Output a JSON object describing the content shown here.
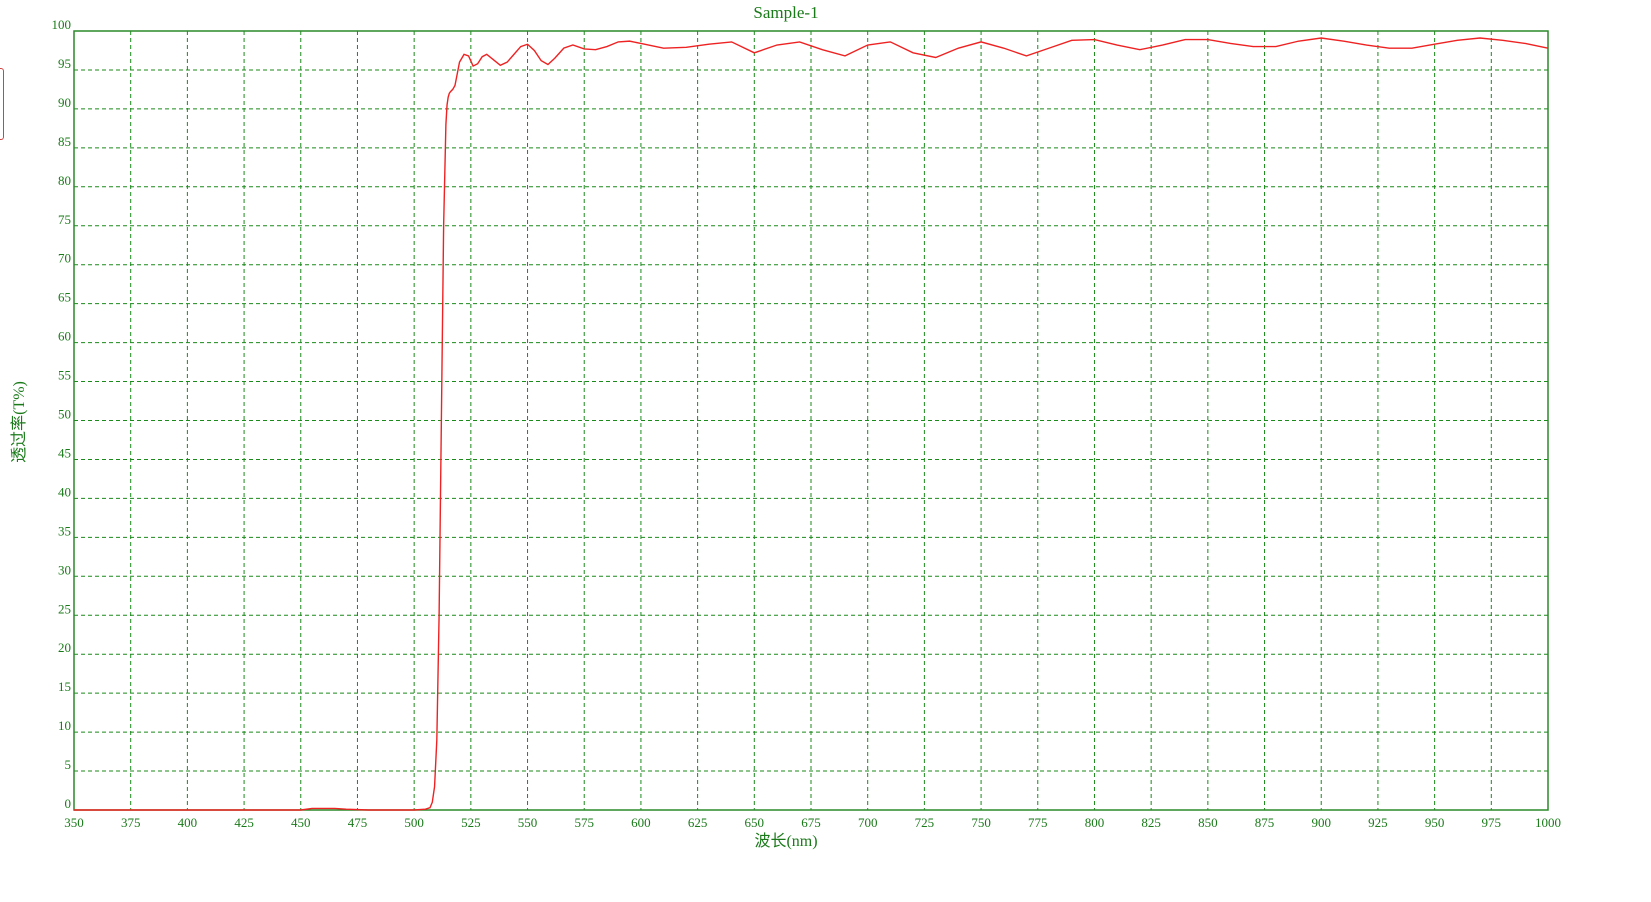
{
  "chart_data": {
    "type": "line",
    "title": "Sample-1",
    "xlabel": "波长(nm)",
    "ylabel": "透过率(T%)",
    "xlim": [
      350,
      1000
    ],
    "ylim": [
      0,
      100
    ],
    "x_ticks": [
      350,
      375,
      400,
      425,
      450,
      475,
      500,
      525,
      550,
      575,
      600,
      625,
      650,
      675,
      700,
      725,
      750,
      775,
      800,
      825,
      850,
      875,
      900,
      925,
      950,
      975,
      1000
    ],
    "y_ticks": [
      0,
      5,
      10,
      15,
      20,
      25,
      30,
      35,
      40,
      45,
      50,
      55,
      60,
      65,
      70,
      75,
      80,
      85,
      90,
      95,
      100
    ],
    "grid": true,
    "colors": {
      "series": "#ee2222",
      "axis": "#1a7a1a"
    },
    "series": [
      {
        "x": [
          350,
          400,
          450,
          455,
          465,
          470,
          480,
          490,
          500,
          505,
          507,
          508,
          509,
          510,
          511,
          512,
          513,
          514,
          514.5,
          515,
          515.5,
          516,
          517,
          518,
          519,
          520,
          522,
          524,
          526,
          528,
          530,
          532,
          535,
          538,
          541,
          544,
          547,
          550,
          553,
          556,
          559,
          562,
          566,
          570,
          575,
          580,
          585,
          590,
          595,
          600,
          610,
          620,
          630,
          640,
          650,
          660,
          670,
          680,
          690,
          700,
          710,
          720,
          730,
          740,
          750,
          760,
          770,
          780,
          790,
          800,
          810,
          820,
          830,
          840,
          850,
          860,
          870,
          880,
          890,
          900,
          910,
          920,
          930,
          940,
          950,
          960,
          970,
          980,
          990,
          1000
        ],
        "y": [
          0,
          0,
          0,
          0.2,
          0.2,
          0.1,
          0,
          0,
          0,
          0.1,
          0.3,
          1,
          3,
          9,
          25,
          50,
          75,
          88,
          90.5,
          91.5,
          92,
          92.2,
          92.5,
          93,
          94.5,
          96,
          97,
          96.8,
          95.5,
          95.8,
          96.7,
          97,
          96.3,
          95.6,
          96,
          97,
          98,
          98.3,
          97.5,
          96.2,
          95.7,
          96.5,
          97.8,
          98.2,
          97.7,
          97.6,
          98,
          98.6,
          98.7,
          98.4,
          97.8,
          97.9,
          98.3,
          98.6,
          97.2,
          98.2,
          98.6,
          97.6,
          96.8,
          98.2,
          98.6,
          97.2,
          96.6,
          97.8,
          98.6,
          97.8,
          96.8,
          97.8,
          98.8,
          98.9,
          98.2,
          97.6,
          98.2,
          98.9,
          98.9,
          98.4,
          98,
          98,
          98.7,
          99.1,
          98.7,
          98.2,
          97.8,
          97.8,
          98.3,
          98.8,
          99.1,
          98.8,
          98.4,
          97.8
        ]
      }
    ]
  }
}
